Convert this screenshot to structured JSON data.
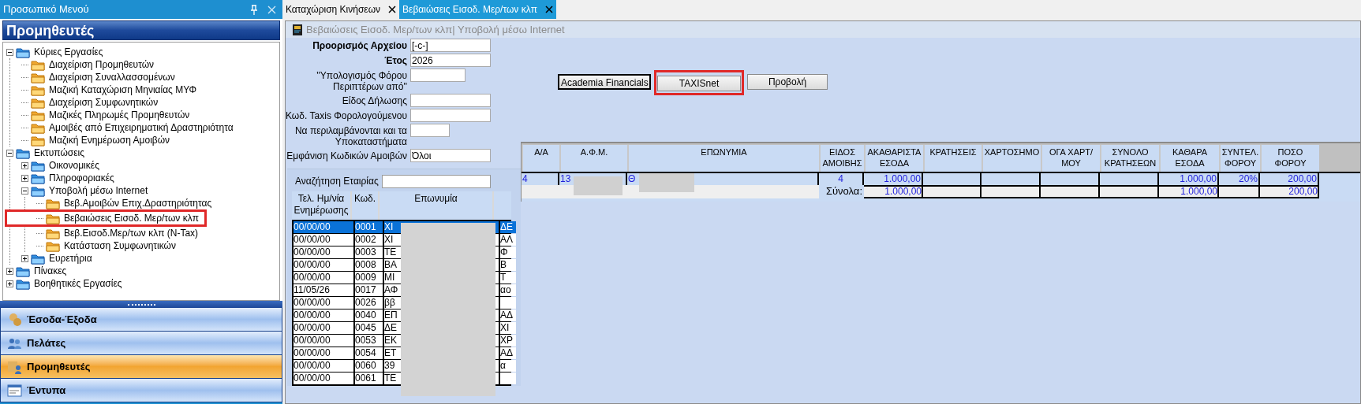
{
  "menu_panel": {
    "title": "Προσωπικό Μενού",
    "header": "Προμηθευτές"
  },
  "tree": [
    {
      "label": "Κύριες Εργασίες",
      "kind": "group",
      "expanded": true,
      "children": [
        {
          "label": "Διαχείριση Προμηθευτών",
          "kind": "item"
        },
        {
          "label": "Διαχείριση Συναλλασσομένων",
          "kind": "item"
        },
        {
          "label": "Μαζική Καταχώριση Μηνιαίας ΜΥΦ",
          "kind": "item"
        },
        {
          "label": "Διαχείριση Συμφωνητικών",
          "kind": "item"
        },
        {
          "label": "Μαζικές Πληρωμές Προμηθευτών",
          "kind": "item"
        },
        {
          "label": "Αμοιβές από Επιχειρηματική Δραστηριότητα",
          "kind": "item"
        },
        {
          "label": "Μαζική Ενημέρωση Αμοιβών",
          "kind": "item"
        }
      ]
    },
    {
      "label": "Εκτυπώσεις",
      "kind": "group",
      "expanded": true,
      "children": [
        {
          "label": "Οικονομικές",
          "kind": "group",
          "expanded": false
        },
        {
          "label": "Πληροφοριακές",
          "kind": "group",
          "expanded": false
        },
        {
          "label": "Υποβολή μέσω Internet",
          "kind": "group",
          "expanded": true,
          "children": [
            {
              "label": "Βεβ.Αμοιβών Επιχ.Δραστηριότητας",
              "kind": "item"
            },
            {
              "label": "Βεβαιώσεις Εισοδ. Μερ/των κλπ",
              "kind": "item",
              "marked": true
            },
            {
              "label": "Βεβ.Εισοδ.Μερ/των κλπ (N-Tax)",
              "kind": "item"
            },
            {
              "label": "Κατάσταση Συμφωνητικών",
              "kind": "item"
            }
          ]
        },
        {
          "label": "Ευρετήρια",
          "kind": "group",
          "expanded": false
        }
      ]
    },
    {
      "label": "Πίνακες",
      "kind": "group",
      "expanded": false
    },
    {
      "label": "Βοηθητικές Εργασίες",
      "kind": "group",
      "expanded": false
    }
  ],
  "nav_buttons": [
    {
      "label": "Έσοδα-Έξοδα",
      "kind": "coins",
      "selected": false
    },
    {
      "label": "Πελάτες",
      "kind": "people",
      "selected": false
    },
    {
      "label": "Προμηθευτές",
      "kind": "supplier",
      "selected": true
    },
    {
      "label": "Έντυπα",
      "kind": "form",
      "selected": false
    }
  ],
  "tabs": [
    {
      "label": "Καταχώριση Κινήσεων",
      "selected": false
    },
    {
      "label": "Βεβαιώσεις Εισοδ. Μερ/των κλπ",
      "selected": true
    }
  ],
  "window": {
    "title": "Βεβαιώσεις Εισοδ. Μερ/των κλπ| Υποβολή μέσω Internet"
  },
  "form_fields": [
    {
      "label": "Προορισμός Αρχείου",
      "value": "[-c-]",
      "bold": true,
      "kind": "wide"
    },
    {
      "label": "Έτος",
      "value": "2026",
      "bold": true,
      "kind": "wide"
    },
    {
      "label": "''Υπολογισμός Φόρου Περιπτέρων από''",
      "bold": false,
      "kind": "medium"
    },
    {
      "label": "Είδος Δήλωσης",
      "bold": false,
      "kind": "wide"
    },
    {
      "label": "Κωδ. Taxis Φορολογούμενου",
      "bold": false,
      "kind": "wide"
    },
    {
      "label": "Να περιλαμβάνονται και τα Υποκαταστήματα",
      "bold": false,
      "kind": "narrow"
    },
    {
      "label": "Εμφάνιση Κωδικών Αμοιβών",
      "value": "Όλοι",
      "bold": false,
      "kind": "wide"
    }
  ],
  "company_search": {
    "label": "Αναζήτηση Εταιρίας"
  },
  "company_list": {
    "columns": [
      "Τελ. Ημ/νία Ενημέρωσης",
      "Κωδ.",
      "Επωνυμία"
    ],
    "rows": [
      {
        "date": "00/00/00",
        "code": "0001",
        "name": "ΧΙ",
        "extra": "ΔΕ",
        "selected": true
      },
      {
        "date": "00/00/00",
        "code": "0002",
        "name": "ΧΙ",
        "extra": "ΑΛ",
        "selected": false
      },
      {
        "date": "00/00/00",
        "code": "0003",
        "name": "ΤΕ",
        "extra": "Φ",
        "selected": false
      },
      {
        "date": "00/00/00",
        "code": "0008",
        "name": "ΒΑ",
        "extra": "Β",
        "selected": false
      },
      {
        "date": "00/00/00",
        "code": "0009",
        "name": "ΜΙ",
        "extra": "Τ",
        "selected": false
      },
      {
        "date": "11/05/26",
        "code": "0017",
        "name": "ΑΦ",
        "extra": "αο",
        "selected": false
      },
      {
        "date": "00/00/00",
        "code": "0026",
        "name": "ββ",
        "selected": false
      },
      {
        "date": "00/00/00",
        "code": "0040",
        "name": "ΕΠ",
        "extra": "ΑΔ",
        "selected": false
      },
      {
        "date": "00/00/00",
        "code": "0045",
        "name": "ΔΕ",
        "extra": "ΧΙ",
        "selected": false
      },
      {
        "date": "00/00/00",
        "code": "0053",
        "name": "ΕΚ",
        "extra": "ΧΡ",
        "selected": false
      },
      {
        "date": "00/00/00",
        "code": "0054",
        "name": "ΕΤ",
        "extra": "ΑΔ",
        "selected": false
      },
      {
        "date": "00/00/00",
        "code": "0060",
        "name": "39",
        "extra": "α",
        "selected": false
      },
      {
        "date": "00/00/00",
        "code": "0061",
        "name": "ΤΕ",
        "selected": false
      }
    ]
  },
  "buttons": [
    {
      "label": "Academia Financials",
      "focused": true,
      "marked": false
    },
    {
      "label": "TAXISnet",
      "focused": false,
      "marked": true
    },
    {
      "label": "Προβολή",
      "focused": false,
      "marked": false
    }
  ],
  "table": {
    "columns": [
      "Α/Α",
      "Α.Φ.Μ.",
      "ΕΠΩΝΥΜΙΑ",
      "ΕΙΔΟΣ ΑΜΟΙΒΗΣ",
      "ΑΚΑΘΑΡΙΣΤΑ ΕΣΟΔΑ",
      "ΚΡΑΤΗΣΕΙΣ",
      "ΧΑΡΤΟΣΗΜΟ",
      "ΟΓΑ ΧΑΡΤ/ΜΟΥ",
      "ΣΥΝΟΛΟ ΚΡΑΤΗΣΕΩΝ",
      "ΚΑΘΑΡΑ ΕΣΟΔΑ",
      "ΣΥΝΤΕΛ. ΦΟΡΟΥ",
      "ΠΟΣΟ ΦΟΡΟΥ"
    ],
    "rows": [
      {
        "cells": [
          "4",
          "13",
          "Θ",
          "4",
          "1.000,00",
          null,
          null,
          null,
          null,
          "1.000,00",
          "20%",
          "200,00"
        ]
      }
    ],
    "totals": {
      "label": "Σύνολα:",
      "cells": [
        "1.000,00",
        null,
        null,
        null,
        null,
        "1.000,00",
        null,
        "200,00"
      ]
    }
  }
}
